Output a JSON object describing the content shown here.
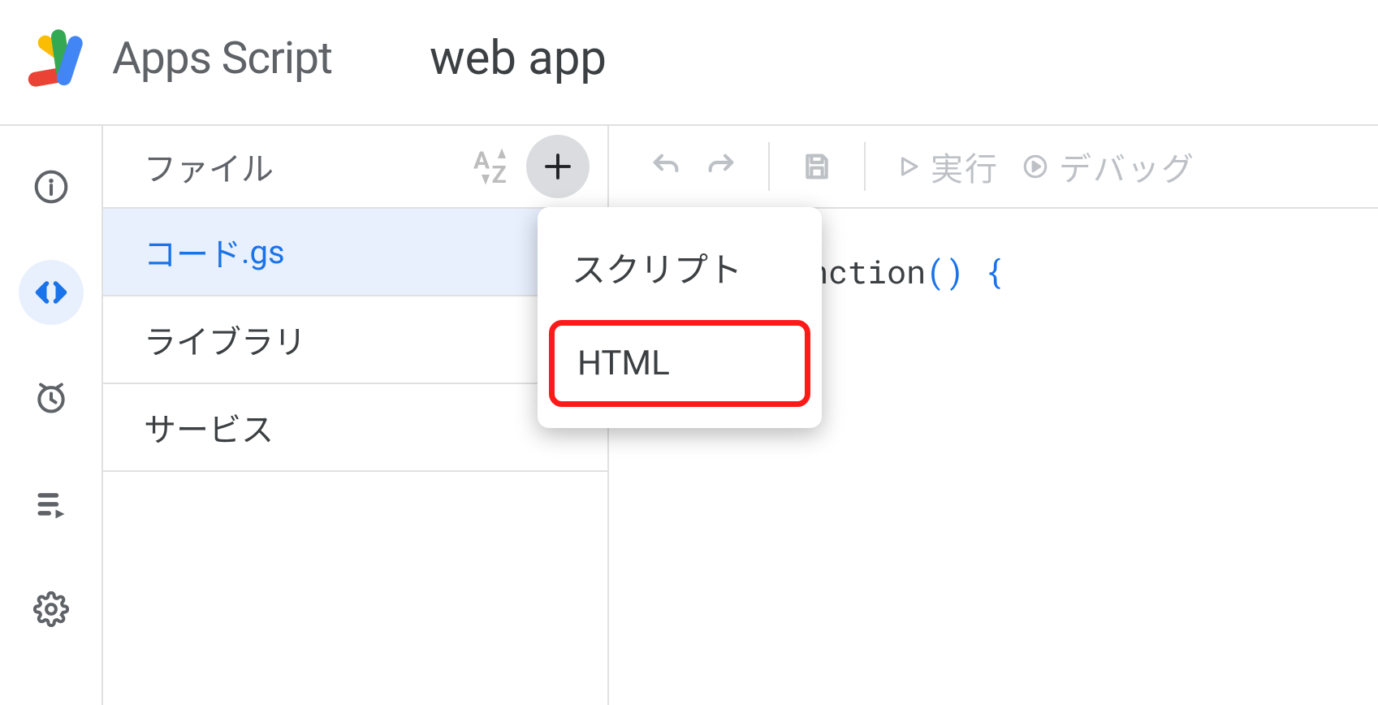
{
  "header": {
    "app_title": "Apps Script",
    "project_title": "web app"
  },
  "files_panel": {
    "header_label": "ファイル",
    "items": [
      {
        "name": "コード",
        "ext": ".gs",
        "selected": true
      }
    ],
    "sections": [
      {
        "label": "ライブラリ"
      },
      {
        "label": "サービス"
      }
    ]
  },
  "add_menu": {
    "items": [
      {
        "label": "スクリプト",
        "highlighted": false
      },
      {
        "label": "HTML",
        "highlighted": true
      }
    ]
  },
  "toolbar": {
    "run_label": "実行",
    "debug_label": "デバッグ"
  },
  "editor": {
    "visible_code": {
      "prefix_fragment": "tion",
      "function_name": "myFunction",
      "parens": "()",
      "brace": "{"
    }
  },
  "icons": {
    "logo": "apps-script-logo-icon",
    "sort": "sort-az-icon",
    "add": "plus-icon",
    "undo": "undo-icon",
    "redo": "redo-icon",
    "save": "save-icon",
    "run": "play-icon",
    "debug": "debug-icon",
    "info": "info-icon",
    "code": "code-icon",
    "clock": "clock-icon",
    "executions": "executions-icon",
    "settings": "gear-icon"
  }
}
